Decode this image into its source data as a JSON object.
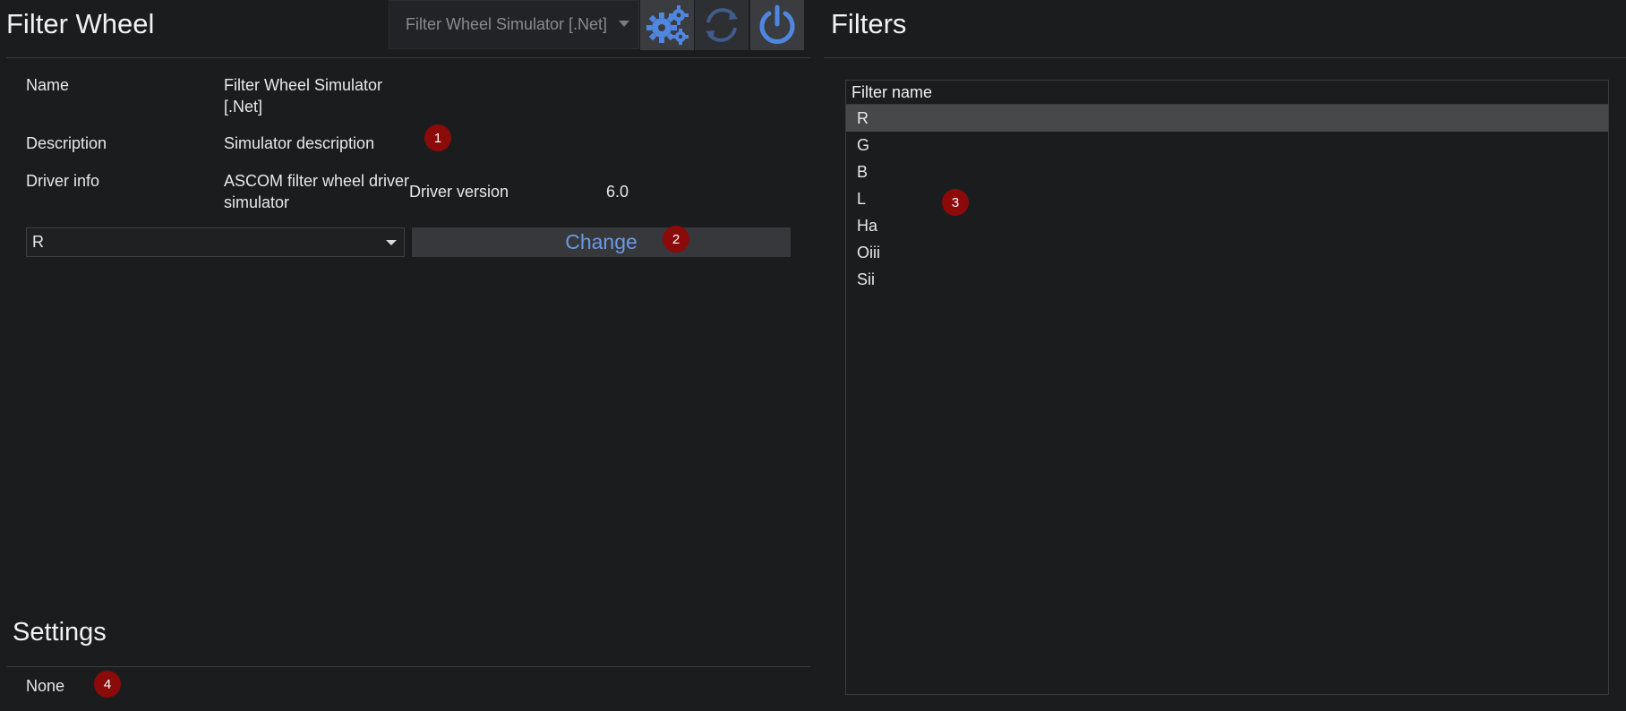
{
  "left_panel": {
    "title": "Filter Wheel",
    "toolbar": {
      "device_selected": "Filter Wheel Simulator [.Net]",
      "icons": [
        "gear-icon",
        "refresh-icon",
        "power-icon"
      ],
      "accent_color": "#4f86e0"
    },
    "info": {
      "name_label": "Name",
      "name_value_line1": "Filter Wheel Simulator",
      "name_value_line2": "[.Net]",
      "description_label": "Description",
      "description_value": "Simulator description",
      "driver_info_label": "Driver info",
      "driver_info_value_line1": "ASCOM filter wheel driver",
      "driver_info_value_line2": "simulator",
      "driver_version_label": "Driver version",
      "driver_version_value": "6.0"
    },
    "filter_select_value": "R",
    "change_label": "Change",
    "settings": {
      "title": "Settings",
      "value": "None"
    }
  },
  "right_panel": {
    "title": "Filters",
    "column_header": "Filter name",
    "filters": [
      "R",
      "G",
      "B",
      "L",
      "Ha",
      "Oiii",
      "Sii"
    ],
    "selected_index": 0
  },
  "badges": [
    "1",
    "2",
    "3",
    "4"
  ],
  "badge_color": "#8b0a0a"
}
